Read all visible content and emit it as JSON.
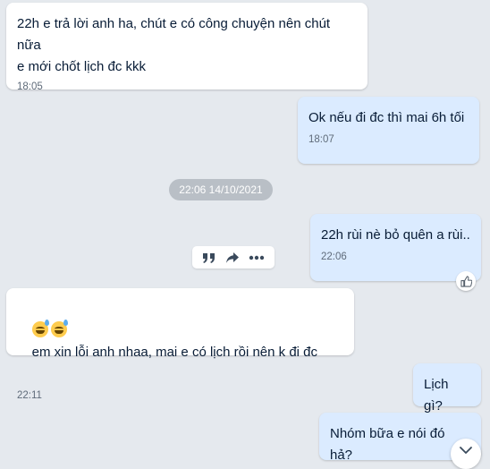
{
  "messages": [
    {
      "text": "22h e trả lời anh ha, chút e có công chuyện nên chút nữa\ne mới chốt lịch đc kkk",
      "time": "18:05"
    },
    {
      "text": "Ok nếu đi đc thì mai 6h tối",
      "time": "18:07"
    },
    {
      "text": "22h rùi nè bỏ quên a rùi..",
      "time": "22:06"
    },
    {
      "text": "em xin lỗi anh nhaa, mai e có lịch rồi nên k đi đc",
      "time": "22:11"
    },
    {
      "text": "Lịch gì?"
    },
    {
      "text": "Nhóm bữa e nói đó hả?"
    }
  ],
  "date_separator": "22:06 14/10/2021",
  "toolbar": {
    "icons": [
      "quote-icon",
      "share-icon",
      "more-icon"
    ]
  },
  "icons": {
    "react": "thumbs-up-icon",
    "scroll_down": "chevron-down-icon",
    "emoji": "grinning-sweat-emoji"
  },
  "colors": {
    "background": "#e5e9ee",
    "incoming_bubble": "#ffffff",
    "outgoing_bubble": "#dbebff",
    "text": "#081c36",
    "time": "#5f6b7a",
    "date_separator": "#b9bfc6"
  }
}
